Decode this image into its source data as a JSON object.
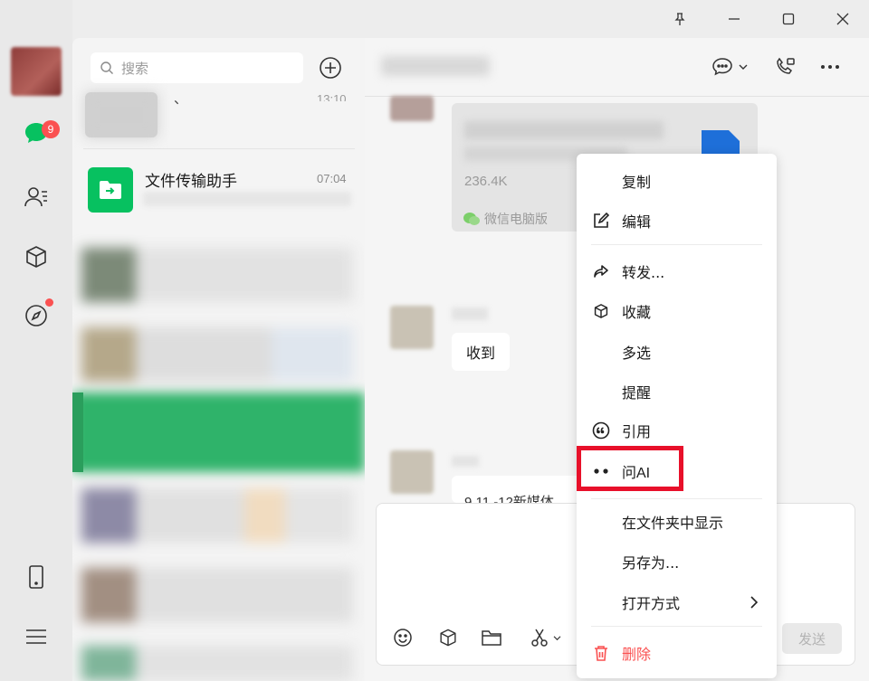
{
  "window": {
    "controls": [
      "pin-icon",
      "minimize-icon",
      "maximize-icon",
      "close-icon"
    ]
  },
  "nav": {
    "chat_badge": "9"
  },
  "chat_list": {
    "search_placeholder": "搜索",
    "partial_time": "13:10",
    "partial_name_char": "、",
    "file_transfer": {
      "name": "文件传输助手",
      "time": "07:04"
    }
  },
  "chat": {
    "file_message": {
      "size": "236.4K",
      "source": "微信电脑版"
    },
    "received_text": "收到",
    "partial_text": "9.11 -12新媒体",
    "send_label": "发送"
  },
  "context_menu": {
    "items": [
      {
        "label": "复制",
        "icon": ""
      },
      {
        "label": "编辑",
        "icon": "edit-icon"
      },
      {
        "label": "转发...",
        "icon": "forward-icon"
      },
      {
        "label": "收藏",
        "icon": "cube-icon"
      },
      {
        "label": "多选",
        "icon": ""
      },
      {
        "label": "提醒",
        "icon": ""
      },
      {
        "label": "引用",
        "icon": "quote-icon"
      },
      {
        "label": "问AI",
        "icon": "ai-dots-icon"
      },
      {
        "label": "在文件夹中显示",
        "icon": ""
      },
      {
        "label": "另存为...",
        "icon": ""
      },
      {
        "label": "打开方式",
        "icon": "chevron-right-icon"
      },
      {
        "label": "删除",
        "icon": "trash-icon"
      }
    ],
    "delete_color": "#fa5151",
    "highlight_color": "#e8102a"
  },
  "colors": {
    "accent": "#07c160",
    "badge": "#fa5151"
  }
}
